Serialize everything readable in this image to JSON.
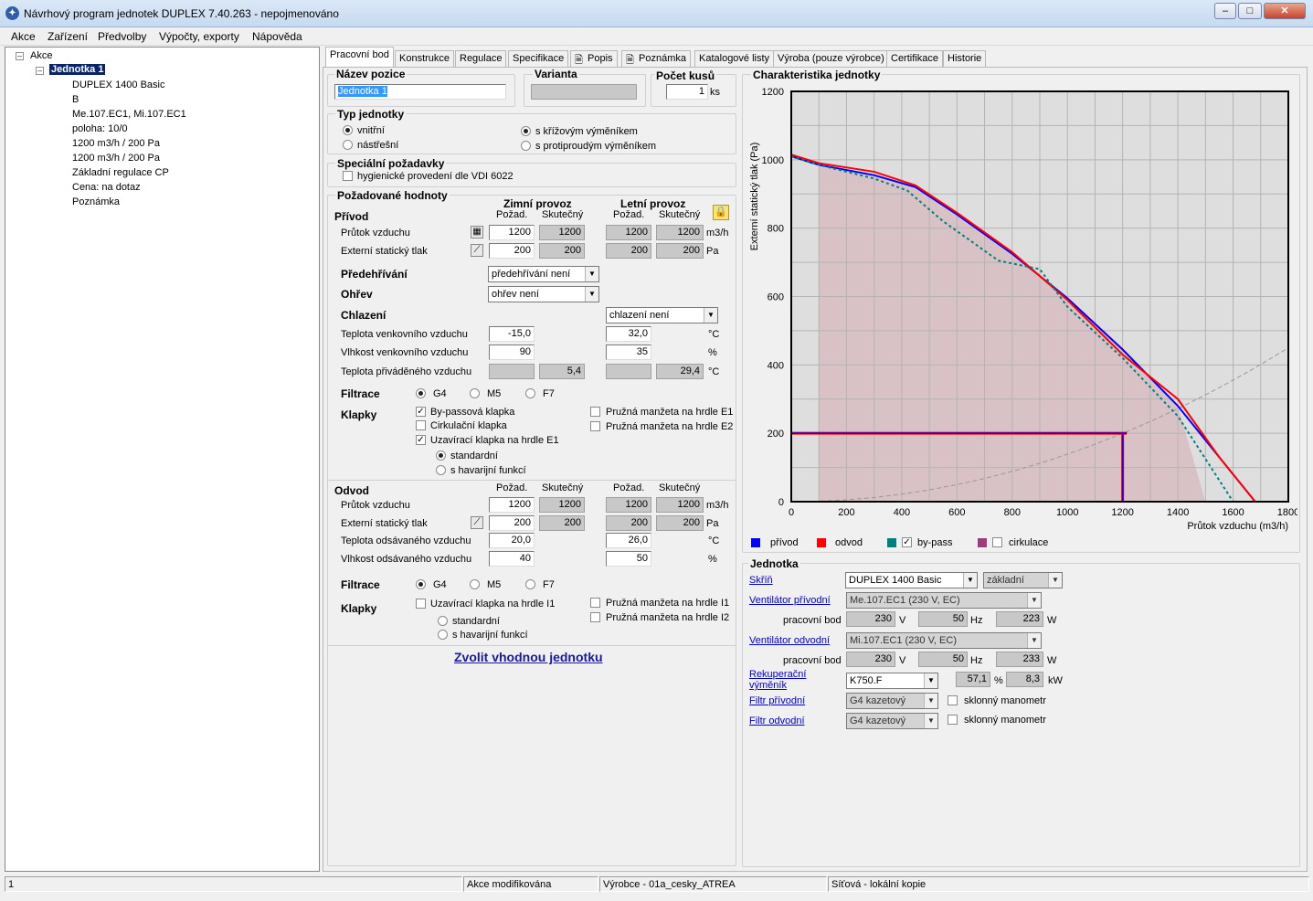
{
  "window": {
    "title": "Návrhový program jednotek DUPLEX 7.40.263 - nepojmenováno"
  },
  "menu": [
    "Akce",
    "Zařízení",
    "Předvolby",
    "Výpočty, exporty",
    "Nápověda"
  ],
  "tree": {
    "root": "Akce",
    "unit": "Jednotka 1",
    "children": [
      "DUPLEX 1400 Basic",
      "B",
      "Me.107.EC1, Mi.107.EC1",
      "poloha: 10/0",
      "1200 m3/h / 200 Pa",
      "1200 m3/h / 200 Pa",
      "Základní regulace CP",
      "Cena: na dotaz",
      "Poznámka"
    ]
  },
  "tabs": [
    "Pracovní bod",
    "Konstrukce",
    "Regulace",
    "Specifikace",
    "Popis",
    "Poznámka",
    "Katalogové listy",
    "Výroba (pouze výrobce)",
    "Certifikace",
    "Historie"
  ],
  "position": {
    "title": "Název pozice",
    "value": "Jednotka 1"
  },
  "variant": {
    "title": "Varianta",
    "value": ""
  },
  "count": {
    "title": "Počet kusů",
    "value": "1",
    "unit": "ks"
  },
  "unit_type": {
    "title": "Typ jednotky",
    "indoor": "vnitřní",
    "roof": "nástřešní",
    "cross": "s křížovým výměníkem",
    "counter": "s protiproudým výměníkem"
  },
  "special": {
    "title": "Speciální požadavky",
    "hygiene": "hygienické provedení dle VDI 6022"
  },
  "req": {
    "title": "Požadované hodnoty",
    "winter": "Zimní provoz",
    "summer": "Letní provoz",
    "pozad": "Požad.",
    "skut": "Skutečný",
    "supply": "Přívod",
    "airflow": "Průtok vzduchu",
    "pressure": "Externí statický tlak",
    "airflow_vals": [
      "1200",
      "1200",
      "1200",
      "1200"
    ],
    "pressure_vals": [
      "200",
      "200",
      "200",
      "200"
    ],
    "unit_flow": "m3/h",
    "unit_pa": "Pa",
    "preheat": "Předehřívání",
    "preheat_val": "předehřívání není",
    "heat": "Ohřev",
    "heat_val": "ohřev není",
    "cool": "Chlazení",
    "cool_val": "chlazení není",
    "outdoor_temp": "Teplota venkovního vzduchu",
    "outdoor_temp_w": "-15,0",
    "outdoor_temp_s": "32,0",
    "outdoor_hum": "Vlhkost venkovního vzduchu",
    "outdoor_hum_w": "90",
    "outdoor_hum_s": "35",
    "supply_temp": "Teplota přiváděného vzduchu",
    "supply_temp_w": "5,4",
    "supply_temp_s": "29,4",
    "unit_c": "°C",
    "unit_pct": "%",
    "filtration": "Filtrace",
    "f_g4": "G4",
    "f_m5": "M5",
    "f_f7": "F7",
    "dampers": "Klapky",
    "bypass": "By-passová klapka",
    "circ": "Cirkulační klapka",
    "closing_e1": "Uzavírací klapka na hrdle E1",
    "standard": "standardní",
    "emergency": "s havarijní funkcí",
    "flex_e1": "Pružná manžeta na hrdle E1",
    "flex_e2": "Pružná manžeta na hrdle E2",
    "exhaust": "Odvod",
    "exhaust_temp": "Teplota odsávaného vzduchu",
    "exhaust_temp_w": "20,0",
    "exhaust_temp_s": "26,0",
    "exhaust_hum": "Vlhkost odsávaného vzduchu",
    "exhaust_hum_w": "40",
    "exhaust_hum_s": "50",
    "closing_i1": "Uzavírací klapka na hrdle I1",
    "flex_i1": "Pružná manžeta na hrdle I1",
    "flex_i2": "Pružná manžeta na hrdle I2",
    "choose": "Zvolit vhodnou jednotku"
  },
  "chart_data": {
    "type": "line",
    "title": "Charakteristika jednotky",
    "xlabel": "Průtok vzduchu (m3/h)",
    "ylabel": "Externí statický tlak (Pa)",
    "xlim": [
      0,
      1800
    ],
    "ylim": [
      0,
      1200
    ],
    "xticks": [
      0,
      200,
      400,
      600,
      800,
      1000,
      1200,
      1400,
      1600,
      1800
    ],
    "yticks": [
      0,
      200,
      400,
      600,
      800,
      1000,
      1200
    ],
    "series": [
      {
        "name": "přívod",
        "color": "#0000ff",
        "x": [
          0,
          100,
          300,
          450,
          600,
          800,
          1000,
          1200,
          1400,
          1550,
          1680
        ],
        "y": [
          1010,
          985,
          955,
          920,
          840,
          725,
          595,
          445,
          280,
          130,
          0
        ]
      },
      {
        "name": "odvod",
        "color": "#ff0000",
        "x": [
          0,
          100,
          300,
          450,
          600,
          800,
          1000,
          1200,
          1400,
          1550,
          1680
        ],
        "y": [
          1015,
          990,
          965,
          925,
          845,
          730,
          590,
          430,
          300,
          130,
          0
        ]
      },
      {
        "name": "by-pass",
        "color": "#008080",
        "x": [
          0,
          100,
          300,
          420,
          550,
          750,
          900,
          1000,
          1200,
          1400,
          1600
        ],
        "y": [
          1010,
          985,
          945,
          910,
          820,
          705,
          680,
          570,
          420,
          250,
          0
        ]
      }
    ],
    "operating_point": {
      "x": 1200,
      "y": 200
    },
    "legend": [
      "přívod",
      "odvod",
      "by-pass",
      "cirkulace"
    ]
  },
  "unitbox": {
    "title": "Jednotka",
    "casing": "Skříň",
    "casing_val": "DUPLEX 1400 Basic",
    "casing_opt": "základní",
    "fan_in": "Ventilátor přívodní",
    "fan_in_val": "Me.107.EC1 (230 V, EC)",
    "fan_out": "Ventilátor odvodní",
    "fan_out_val": "Mi.107.EC1 (230 V, EC)",
    "work_point": "pracovní bod",
    "fan_in_v": "230",
    "fan_in_hz": "50",
    "fan_in_w": "223",
    "fan_out_v": "230",
    "fan_out_hz": "50",
    "fan_out_w": "233",
    "u_v": "V",
    "u_hz": "Hz",
    "u_w": "W",
    "recup_line1": "Rekuperační",
    "recup_line2": "výměník",
    "recup_val": "K750.F",
    "recup_pct": "57,1",
    "recup_kw": "8,3",
    "u_pct": "%",
    "u_kw": "kW",
    "filter_in": "Filtr přívodní",
    "filter_out": "Filtr odvodní",
    "filter_val": "G4 kazetový",
    "manometer": "sklonný manometr"
  },
  "status": [
    "1",
    "Akce modifikována",
    "Výrobce - 01a_cesky_ATREA",
    "Síťová - lokální kopie"
  ]
}
